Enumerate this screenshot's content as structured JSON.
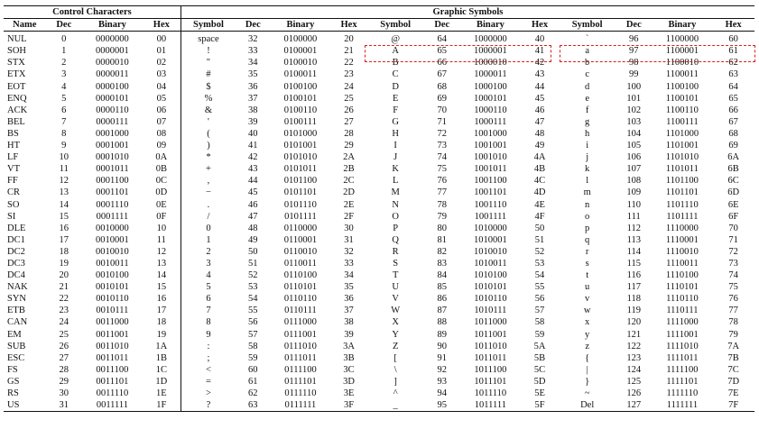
{
  "groups": {
    "control": "Control Characters",
    "graphic": "Graphic Symbols"
  },
  "columns": {
    "control": [
      "Name",
      "Dec",
      "Binary",
      "Hex"
    ],
    "graphic": [
      "Symbol",
      "Dec",
      "Binary",
      "Hex"
    ]
  },
  "rows": [
    [
      "NUL",
      "0",
      "0000000",
      "00",
      "space",
      "32",
      "0100000",
      "20",
      "@",
      "64",
      "1000000",
      "40",
      "`",
      "96",
      "1100000",
      "60"
    ],
    [
      "SOH",
      "1",
      "0000001",
      "01",
      "!",
      "33",
      "0100001",
      "21",
      "A",
      "65",
      "1000001",
      "41",
      "a",
      "97",
      "1100001",
      "61"
    ],
    [
      "STX",
      "2",
      "0000010",
      "02",
      "\"",
      "34",
      "0100010",
      "22",
      "B",
      "66",
      "1000010",
      "42",
      "b",
      "98",
      "1100010",
      "62"
    ],
    [
      "ETX",
      "3",
      "0000011",
      "03",
      "#",
      "35",
      "0100011",
      "23",
      "C",
      "67",
      "1000011",
      "43",
      "c",
      "99",
      "1100011",
      "63"
    ],
    [
      "EOT",
      "4",
      "0000100",
      "04",
      "$",
      "36",
      "0100100",
      "24",
      "D",
      "68",
      "1000100",
      "44",
      "d",
      "100",
      "1100100",
      "64"
    ],
    [
      "ENQ",
      "5",
      "0000101",
      "05",
      "%",
      "37",
      "0100101",
      "25",
      "E",
      "69",
      "1000101",
      "45",
      "e",
      "101",
      "1100101",
      "65"
    ],
    [
      "ACK",
      "6",
      "0000110",
      "06",
      "&",
      "38",
      "0100110",
      "26",
      "F",
      "70",
      "1000110",
      "46",
      "f",
      "102",
      "1100110",
      "66"
    ],
    [
      "BEL",
      "7",
      "0000111",
      "07",
      "'",
      "39",
      "0100111",
      "27",
      "G",
      "71",
      "1000111",
      "47",
      "g",
      "103",
      "1100111",
      "67"
    ],
    [
      "BS",
      "8",
      "0001000",
      "08",
      "(",
      "40",
      "0101000",
      "28",
      "H",
      "72",
      "1001000",
      "48",
      "h",
      "104",
      "1101000",
      "68"
    ],
    [
      "HT",
      "9",
      "0001001",
      "09",
      ")",
      "41",
      "0101001",
      "29",
      "I",
      "73",
      "1001001",
      "49",
      "i",
      "105",
      "1101001",
      "69"
    ],
    [
      "LF",
      "10",
      "0001010",
      "0A",
      "*",
      "42",
      "0101010",
      "2A",
      "J",
      "74",
      "1001010",
      "4A",
      "j",
      "106",
      "1101010",
      "6A"
    ],
    [
      "VT",
      "11",
      "0001011",
      "0B",
      "+",
      "43",
      "0101011",
      "2B",
      "K",
      "75",
      "1001011",
      "4B",
      "k",
      "107",
      "1101011",
      "6B"
    ],
    [
      "FF",
      "12",
      "0001100",
      "0C",
      ",",
      "44",
      "0101100",
      "2C",
      "L",
      "76",
      "1001100",
      "4C",
      "l",
      "108",
      "1101100",
      "6C"
    ],
    [
      "CR",
      "13",
      "0001101",
      "0D",
      "−",
      "45",
      "0101101",
      "2D",
      "M",
      "77",
      "1001101",
      "4D",
      "m",
      "109",
      "1101101",
      "6D"
    ],
    [
      "SO",
      "14",
      "0001110",
      "0E",
      ".",
      "46",
      "0101110",
      "2E",
      "N",
      "78",
      "1001110",
      "4E",
      "n",
      "110",
      "1101110",
      "6E"
    ],
    [
      "SI",
      "15",
      "0001111",
      "0F",
      "/",
      "47",
      "0101111",
      "2F",
      "O",
      "79",
      "1001111",
      "4F",
      "o",
      "111",
      "1101111",
      "6F"
    ],
    [
      "DLE",
      "16",
      "0010000",
      "10",
      "0",
      "48",
      "0110000",
      "30",
      "P",
      "80",
      "1010000",
      "50",
      "p",
      "112",
      "1110000",
      "70"
    ],
    [
      "DC1",
      "17",
      "0010001",
      "11",
      "1",
      "49",
      "0110001",
      "31",
      "Q",
      "81",
      "1010001",
      "51",
      "q",
      "113",
      "1110001",
      "71"
    ],
    [
      "DC2",
      "18",
      "0010010",
      "12",
      "2",
      "50",
      "0110010",
      "32",
      "R",
      "82",
      "1010010",
      "52",
      "r",
      "114",
      "1110010",
      "72"
    ],
    [
      "DC3",
      "19",
      "0010011",
      "13",
      "3",
      "51",
      "0110011",
      "33",
      "S",
      "83",
      "1010011",
      "53",
      "s",
      "115",
      "1110011",
      "73"
    ],
    [
      "DC4",
      "20",
      "0010100",
      "14",
      "4",
      "52",
      "0110100",
      "34",
      "T",
      "84",
      "1010100",
      "54",
      "t",
      "116",
      "1110100",
      "74"
    ],
    [
      "NAK",
      "21",
      "0010101",
      "15",
      "5",
      "53",
      "0110101",
      "35",
      "U",
      "85",
      "1010101",
      "55",
      "u",
      "117",
      "1110101",
      "75"
    ],
    [
      "SYN",
      "22",
      "0010110",
      "16",
      "6",
      "54",
      "0110110",
      "36",
      "V",
      "86",
      "1010110",
      "56",
      "v",
      "118",
      "1110110",
      "76"
    ],
    [
      "ETB",
      "23",
      "0010111",
      "17",
      "7",
      "55",
      "0110111",
      "37",
      "W",
      "87",
      "1010111",
      "57",
      "w",
      "119",
      "1110111",
      "77"
    ],
    [
      "CAN",
      "24",
      "0011000",
      "18",
      "8",
      "56",
      "0111000",
      "38",
      "X",
      "88",
      "1011000",
      "58",
      "x",
      "120",
      "1111000",
      "78"
    ],
    [
      "EM",
      "25",
      "0011001",
      "19",
      "9",
      "57",
      "0111001",
      "39",
      "Y",
      "89",
      "1011001",
      "59",
      "y",
      "121",
      "1111001",
      "79"
    ],
    [
      "SUB",
      "26",
      "0011010",
      "1A",
      ":",
      "58",
      "0111010",
      "3A",
      "Z",
      "90",
      "1011010",
      "5A",
      "z",
      "122",
      "1111010",
      "7A"
    ],
    [
      "ESC",
      "27",
      "0011011",
      "1B",
      ";",
      "59",
      "0111011",
      "3B",
      "[",
      "91",
      "1011011",
      "5B",
      "{",
      "123",
      "1111011",
      "7B"
    ],
    [
      "FS",
      "28",
      "0011100",
      "1C",
      "<",
      "60",
      "0111100",
      "3C",
      "\\",
      "92",
      "1011100",
      "5C",
      "|",
      "124",
      "1111100",
      "7C"
    ],
    [
      "GS",
      "29",
      "0011101",
      "1D",
      "=",
      "61",
      "0111101",
      "3D",
      "]",
      "93",
      "1011101",
      "5D",
      "}",
      "125",
      "1111101",
      "7D"
    ],
    [
      "RS",
      "30",
      "0011110",
      "1E",
      ">",
      "62",
      "0111110",
      "3E",
      "^",
      "94",
      "1011110",
      "5E",
      "~",
      "126",
      "1111110",
      "7E"
    ],
    [
      "US",
      "31",
      "0011111",
      "1F",
      "?",
      "63",
      "0111111",
      "3F",
      "_",
      "95",
      "1011111",
      "5F",
      "Del",
      "127",
      "1111111",
      "7F"
    ]
  ],
  "highlight_color": "#d42020"
}
